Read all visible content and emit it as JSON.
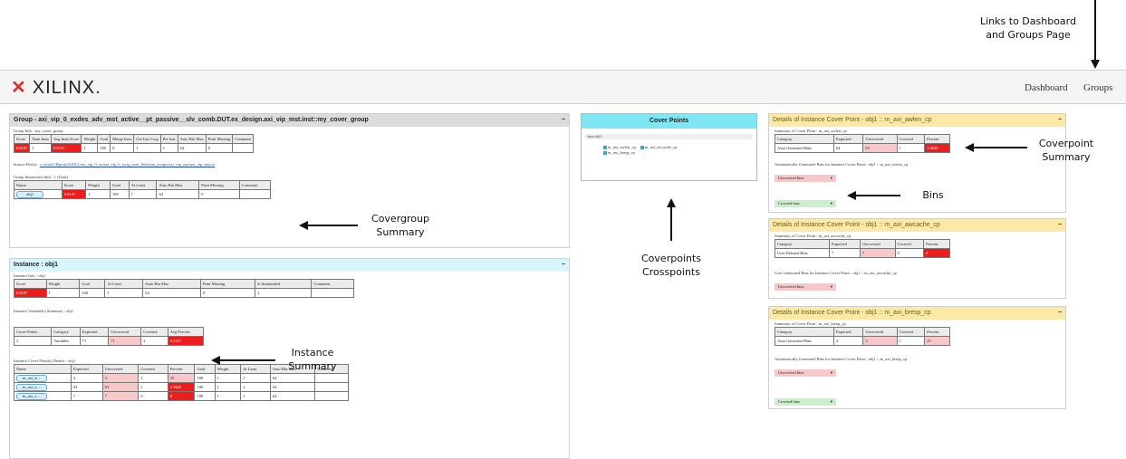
{
  "annotations": {
    "links_line1": "Links to Dashboard",
    "links_line2": "and Groups Page",
    "covergroup_line1": "Covergroup",
    "covergroup_line2": "Summary",
    "instance_line1": "Instance",
    "instance_line2": "Summary",
    "coverpoints_line1": "Coverpoints",
    "coverpoints_line2": "Crosspoints",
    "coverpoint_line1": "Coverpoint",
    "coverpoint_line2": "Summary",
    "bins": "Bins"
  },
  "header": {
    "logo_text": "XILINX.",
    "dashboard": "Dashboard",
    "groups": "Groups"
  },
  "group_panel": {
    "title": "Group - axi_vip_0_exdes_adv_mst_active__pt_passive__slv_comb.DUT.ex_design.axi_vip_mst.inst::my_cover_group",
    "info_label": "Group Info - my_cover_group",
    "info_headers": [
      "Score",
      "Num Insts",
      "Avg Insts Score",
      "Weight",
      "Goal",
      "Merge Insts",
      "Get Inst Cvrg",
      "Per Inst",
      "Auto Bin Max",
      "Print Missing",
      "Comment"
    ],
    "info_row": [
      "0.8107",
      "1",
      "0.8107",
      "1",
      "100",
      "0",
      "1",
      "1",
      "64",
      "0",
      ""
    ],
    "source_label": "Source File(s) :",
    "source_path": "c:/work/CRprojs/2018.1/axi_vip_0_ex/axi_vip_0_ex.ip_user_files/sim_scripts/axi_vip_mst/axi_vip_mst.sv",
    "instances_label": "Group Instance(s) Info : 1 (Total)",
    "inst_headers": [
      "Name",
      "Score",
      "Weight",
      "Goal",
      "At Least",
      "Auto Bin Max",
      "Print Missing",
      "Comment"
    ],
    "inst_row": [
      "obj1",
      "0.8107",
      "1",
      "100",
      "1",
      "64",
      "0",
      ""
    ]
  },
  "instance_panel": {
    "title": "Instance : obj1",
    "info_label": "Instance Info - obj1",
    "info_headers": [
      "Score",
      "Weight",
      "Goal",
      "At Least",
      "Auto Bin Max",
      "Print Missing",
      "Is Instantiated",
      "Comment"
    ],
    "info_row": [
      "0.8107",
      "1",
      "100",
      "1",
      "64",
      "0",
      "1",
      ""
    ],
    "vars_label": "Instance Variable(s) Summary - obj1",
    "vars_headers": [
      "Cover Points",
      "Category",
      "Expected",
      "Uncovered",
      "Covered",
      "Avg Percent"
    ],
    "vars_row": [
      "3",
      "Variables",
      "71",
      "71",
      "2",
      "0.8107"
    ],
    "cp_label": "Instance Cover Point(s) Details - obj1",
    "cp_headers": [
      "Name",
      "Expected",
      "Uncovered",
      "Covered",
      "Percent",
      "Goal",
      "Weight",
      "At Least",
      "Auto Bin Max",
      "Comment"
    ],
    "cp_rows": [
      [
        "m_axi_b ...",
        "4",
        "3",
        "1",
        "25",
        "100",
        "1",
        "1",
        "64",
        ""
      ],
      [
        "m_axi_a ...",
        "64",
        "63",
        "1",
        "1.5625",
        "100",
        "1",
        "1",
        "64",
        ""
      ],
      [
        "m_axi_a ...",
        "7",
        "7",
        "0",
        "0",
        "100",
        "1",
        "1",
        "64",
        ""
      ]
    ]
  },
  "cover_points_panel": {
    "title": "Cover Points",
    "tree_root": "- inst obj1",
    "items": [
      "m_axi_awlen_cp",
      "m_axi_awcache_cp",
      "m_axi_bresp_cp"
    ]
  },
  "details": [
    {
      "title": "Details of Instance Cover Point - obj1 :: m_axi_awlen_cp",
      "summary_label": "Summary of Cover Point - m_axi_awlen_cp",
      "headers": [
        "Category",
        "Expected",
        "Uncovered",
        "Covered",
        "Percent"
      ],
      "row": [
        "Auto Generated Bins",
        "64",
        "63",
        "1",
        "1.5625"
      ],
      "bins_label": "Automatically Generated Bins for Instance Cover Point - obj1 :: m_axi_awlen_cp",
      "uncovered": "Uncovered bins",
      "covered": "Covered bins"
    },
    {
      "title": "Details of Instance Cover Point - obj1 :: m_axi_awcache_cp",
      "summary_label": "Summary of Cover Point - m_axi_awcache_cp",
      "headers": [
        "Category",
        "Expected",
        "Uncovered",
        "Covered",
        "Percent"
      ],
      "row": [
        "User Defined Bins",
        "7",
        "7",
        "0",
        "0"
      ],
      "bins_label": "User Generated Bins for Instance Cover Point - obj1 :: m_axi_awcache_cp",
      "uncovered": "Uncovered bins"
    },
    {
      "title": "Details of Instance Cover Point - obj1 :: m_axi_bresp_cp",
      "summary_label": "Summary of Cover Point - m_axi_bresp_cp",
      "headers": [
        "Category",
        "Expected",
        "Uncovered",
        "Covered",
        "Percent"
      ],
      "row": [
        "Auto Generated Bins",
        "4",
        "3",
        "1",
        "25"
      ],
      "bins_label": "Automatically Generated Bins for Instance Cover Point - obj1 :: m_axi_bresp_cp",
      "uncovered": "Uncovered bins",
      "covered": "Covered bins"
    }
  ]
}
